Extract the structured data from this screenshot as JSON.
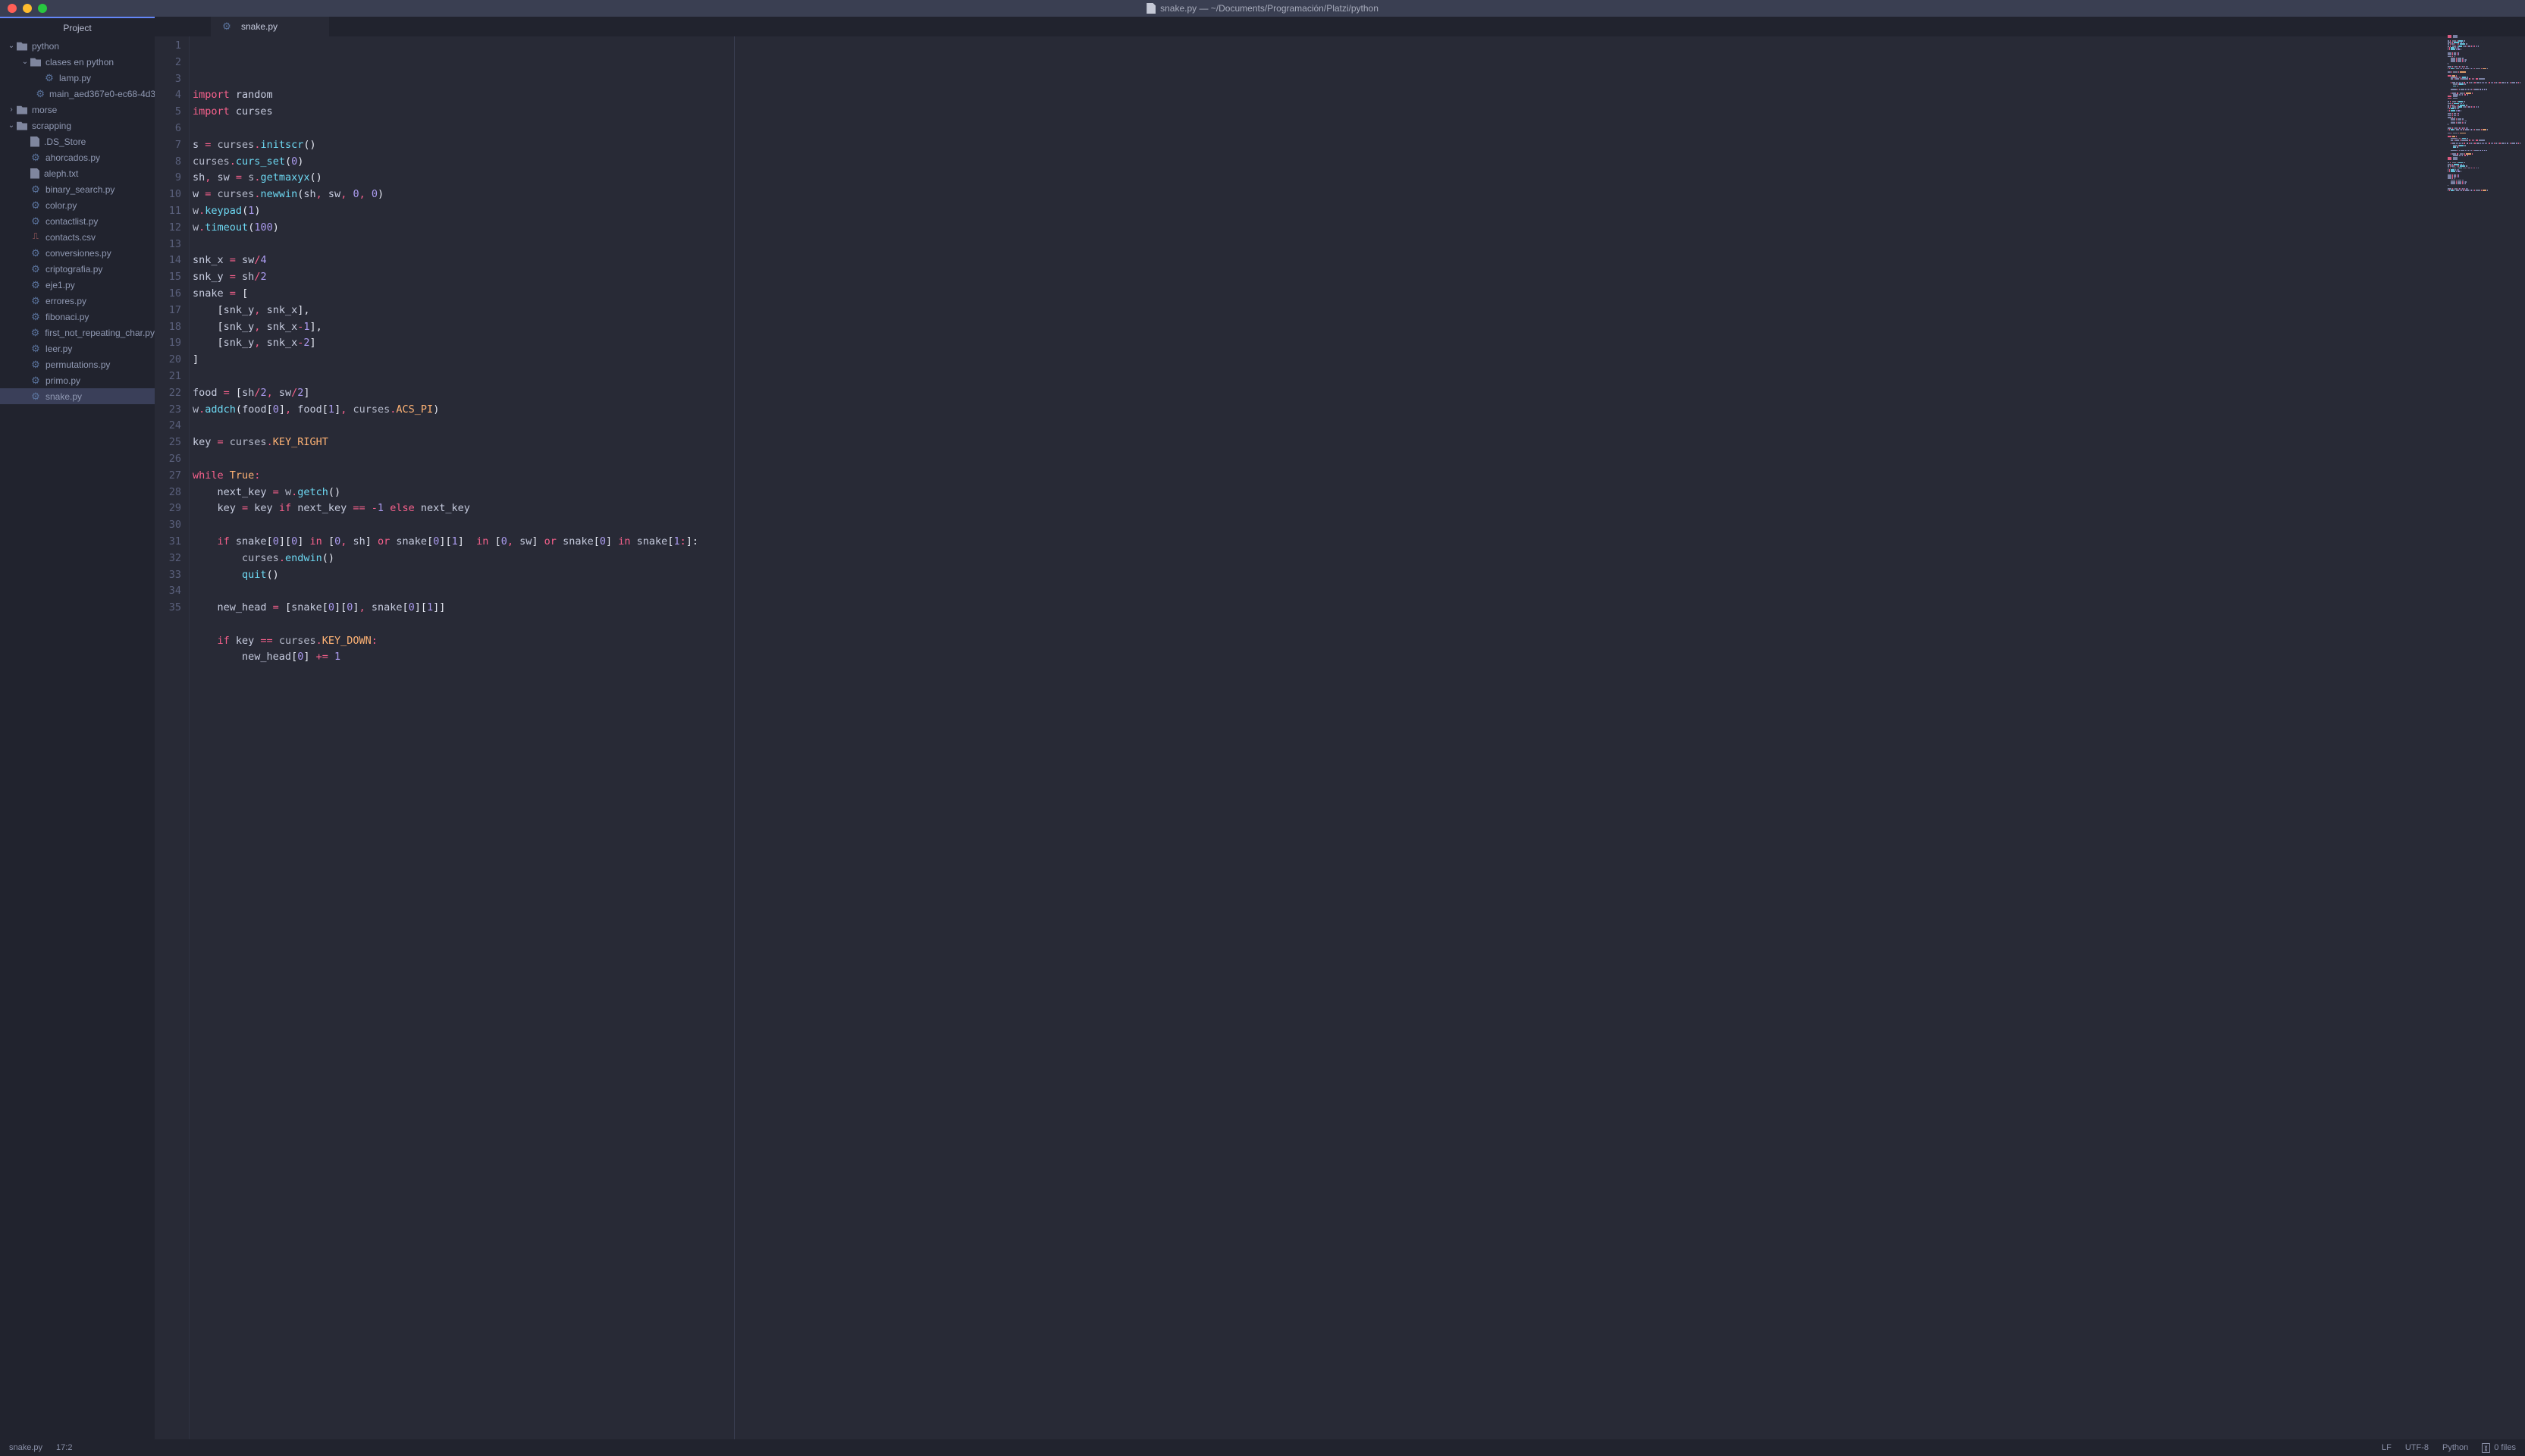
{
  "window": {
    "title": "snake.py — ~/Documents/Programación/Platzi/python"
  },
  "sidebar": {
    "title": "Project",
    "tree": [
      {
        "depth": 0,
        "type": "folder",
        "chev": "down",
        "label": "python"
      },
      {
        "depth": 1,
        "type": "folder",
        "chev": "down",
        "label": "clases en python"
      },
      {
        "depth": 2,
        "type": "py",
        "chev": "none",
        "label": "lamp.py"
      },
      {
        "depth": 2,
        "type": "py",
        "chev": "none",
        "label": "main_aed367e0-ec68-4d3…"
      },
      {
        "depth": 0,
        "type": "folder",
        "chev": "right",
        "label": "morse"
      },
      {
        "depth": 0,
        "type": "folder",
        "chev": "down",
        "label": "scrapping"
      },
      {
        "depth": 1,
        "type": "txt",
        "chev": "none",
        "label": ".DS_Store"
      },
      {
        "depth": 1,
        "type": "py",
        "chev": "none",
        "label": "ahorcados.py"
      },
      {
        "depth": 1,
        "type": "txt",
        "chev": "none",
        "label": "aleph.txt"
      },
      {
        "depth": 1,
        "type": "py",
        "chev": "none",
        "label": "binary_search.py"
      },
      {
        "depth": 1,
        "type": "py",
        "chev": "none",
        "label": "color.py"
      },
      {
        "depth": 1,
        "type": "py",
        "chev": "none",
        "label": "contactlist.py"
      },
      {
        "depth": 1,
        "type": "csv",
        "chev": "none",
        "label": "contacts.csv"
      },
      {
        "depth": 1,
        "type": "py",
        "chev": "none",
        "label": "conversiones.py"
      },
      {
        "depth": 1,
        "type": "py",
        "chev": "none",
        "label": "criptografia.py"
      },
      {
        "depth": 1,
        "type": "py",
        "chev": "none",
        "label": "eje1.py"
      },
      {
        "depth": 1,
        "type": "py",
        "chev": "none",
        "label": "errores.py"
      },
      {
        "depth": 1,
        "type": "py",
        "chev": "none",
        "label": "fibonaci.py"
      },
      {
        "depth": 1,
        "type": "py",
        "chev": "none",
        "label": "first_not_repeating_char.py"
      },
      {
        "depth": 1,
        "type": "py",
        "chev": "none",
        "label": "leer.py"
      },
      {
        "depth": 1,
        "type": "py",
        "chev": "none",
        "label": "permutations.py"
      },
      {
        "depth": 1,
        "type": "py",
        "chev": "none",
        "label": "primo.py"
      },
      {
        "depth": 1,
        "type": "py",
        "chev": "none",
        "label": "snake.py",
        "selected": true
      }
    ]
  },
  "tabs": [
    {
      "label": "snake.py",
      "icon": "python"
    }
  ],
  "code": {
    "lines": [
      [
        [
          "kw",
          "import"
        ],
        [
          "sp",
          " "
        ],
        [
          "var",
          "random"
        ]
      ],
      [
        [
          "kw",
          "import"
        ],
        [
          "sp",
          " "
        ],
        [
          "var",
          "curses"
        ]
      ],
      [],
      [
        [
          "var",
          "s "
        ],
        [
          "op",
          "="
        ],
        [
          "sp",
          " "
        ],
        [
          "builtin",
          "curses"
        ],
        [
          "op",
          "."
        ],
        [
          "fn",
          "initscr"
        ],
        [
          "bracket",
          "()"
        ]
      ],
      [
        [
          "builtin",
          "curses"
        ],
        [
          "op",
          "."
        ],
        [
          "fn",
          "curs_set"
        ],
        [
          "bracket",
          "("
        ],
        [
          "num",
          "0"
        ],
        [
          "bracket",
          ")"
        ]
      ],
      [
        [
          "var",
          "sh"
        ],
        [
          "op",
          ","
        ],
        [
          "var",
          " sw "
        ],
        [
          "op",
          "="
        ],
        [
          "sp",
          " "
        ],
        [
          "builtin",
          "s"
        ],
        [
          "op",
          "."
        ],
        [
          "fn",
          "getmaxyx"
        ],
        [
          "bracket",
          "()"
        ]
      ],
      [
        [
          "var",
          "w "
        ],
        [
          "op",
          "="
        ],
        [
          "sp",
          " "
        ],
        [
          "builtin",
          "curses"
        ],
        [
          "op",
          "."
        ],
        [
          "fn",
          "newwin"
        ],
        [
          "bracket",
          "("
        ],
        [
          "var",
          "sh"
        ],
        [
          "op",
          ","
        ],
        [
          "var",
          " sw"
        ],
        [
          "op",
          ","
        ],
        [
          "sp",
          " "
        ],
        [
          "num",
          "0"
        ],
        [
          "op",
          ","
        ],
        [
          "sp",
          " "
        ],
        [
          "num",
          "0"
        ],
        [
          "bracket",
          ")"
        ]
      ],
      [
        [
          "builtin",
          "w"
        ],
        [
          "op",
          "."
        ],
        [
          "fn",
          "keypad"
        ],
        [
          "bracket",
          "("
        ],
        [
          "num",
          "1"
        ],
        [
          "bracket",
          ")"
        ]
      ],
      [
        [
          "builtin",
          "w"
        ],
        [
          "op",
          "."
        ],
        [
          "fn",
          "timeout"
        ],
        [
          "bracket",
          "("
        ],
        [
          "num",
          "100"
        ],
        [
          "bracket",
          ")"
        ]
      ],
      [],
      [
        [
          "var",
          "snk_x "
        ],
        [
          "op",
          "="
        ],
        [
          "var",
          " sw"
        ],
        [
          "op",
          "/"
        ],
        [
          "num",
          "4"
        ]
      ],
      [
        [
          "var",
          "snk_y "
        ],
        [
          "op",
          "="
        ],
        [
          "var",
          " sh"
        ],
        [
          "op",
          "/"
        ],
        [
          "num",
          "2"
        ]
      ],
      [
        [
          "var",
          "snake "
        ],
        [
          "op",
          "="
        ],
        [
          "sp",
          " "
        ],
        [
          "bracket",
          "["
        ]
      ],
      [
        [
          "sp",
          "    "
        ],
        [
          "bracket",
          "["
        ],
        [
          "var",
          "snk_y"
        ],
        [
          "op",
          ","
        ],
        [
          "var",
          " snk_x"
        ],
        [
          "bracket",
          "],"
        ]
      ],
      [
        [
          "sp",
          "    "
        ],
        [
          "bracket",
          "["
        ],
        [
          "var",
          "snk_y"
        ],
        [
          "op",
          ","
        ],
        [
          "var",
          " snk_x"
        ],
        [
          "op",
          "-"
        ],
        [
          "num",
          "1"
        ],
        [
          "bracket",
          "],"
        ]
      ],
      [
        [
          "sp",
          "    "
        ],
        [
          "bracket",
          "["
        ],
        [
          "var",
          "snk_y"
        ],
        [
          "op",
          ","
        ],
        [
          "var",
          " snk_x"
        ],
        [
          "op",
          "-"
        ],
        [
          "num",
          "2"
        ],
        [
          "bracket",
          "]"
        ]
      ],
      [
        [
          "bracket",
          "]"
        ]
      ],
      [],
      [
        [
          "var",
          "food "
        ],
        [
          "op",
          "="
        ],
        [
          "sp",
          " "
        ],
        [
          "bracket",
          "["
        ],
        [
          "var",
          "sh"
        ],
        [
          "op",
          "/"
        ],
        [
          "num",
          "2"
        ],
        [
          "op",
          ","
        ],
        [
          "var",
          " sw"
        ],
        [
          "op",
          "/"
        ],
        [
          "num",
          "2"
        ],
        [
          "bracket",
          "]"
        ]
      ],
      [
        [
          "builtin",
          "w"
        ],
        [
          "op",
          "."
        ],
        [
          "fn",
          "addch"
        ],
        [
          "bracket",
          "("
        ],
        [
          "var",
          "food"
        ],
        [
          "bracket",
          "["
        ],
        [
          "num",
          "0"
        ],
        [
          "bracket",
          "]"
        ],
        [
          "op",
          ","
        ],
        [
          "var",
          " food"
        ],
        [
          "bracket",
          "["
        ],
        [
          "num",
          "1"
        ],
        [
          "bracket",
          "]"
        ],
        [
          "op",
          ","
        ],
        [
          "sp",
          " "
        ],
        [
          "builtin",
          "curses"
        ],
        [
          "op",
          "."
        ],
        [
          "const",
          "ACS_PI"
        ],
        [
          "bracket",
          ")"
        ]
      ],
      [],
      [
        [
          "var",
          "key "
        ],
        [
          "op",
          "="
        ],
        [
          "sp",
          " "
        ],
        [
          "builtin",
          "curses"
        ],
        [
          "op",
          "."
        ],
        [
          "const",
          "KEY_RIGHT"
        ]
      ],
      [],
      [
        [
          "kw",
          "while"
        ],
        [
          "sp",
          " "
        ],
        [
          "const",
          "True"
        ],
        [
          "op",
          ":"
        ]
      ],
      [
        [
          "sp",
          "    "
        ],
        [
          "var",
          "next_key "
        ],
        [
          "op",
          "="
        ],
        [
          "sp",
          " "
        ],
        [
          "builtin",
          "w"
        ],
        [
          "op",
          "."
        ],
        [
          "fn",
          "getch"
        ],
        [
          "bracket",
          "()"
        ]
      ],
      [
        [
          "sp",
          "    "
        ],
        [
          "var",
          "key "
        ],
        [
          "op",
          "="
        ],
        [
          "var",
          " key "
        ],
        [
          "kw",
          "if"
        ],
        [
          "var",
          " next_key "
        ],
        [
          "op",
          "=="
        ],
        [
          "sp",
          " "
        ],
        [
          "op",
          "-"
        ],
        [
          "num",
          "1"
        ],
        [
          "sp",
          " "
        ],
        [
          "kw",
          "else"
        ],
        [
          "var",
          " next_key"
        ]
      ],
      [],
      [
        [
          "sp",
          "    "
        ],
        [
          "kw",
          "if"
        ],
        [
          "var",
          " snake"
        ],
        [
          "bracket",
          "["
        ],
        [
          "num",
          "0"
        ],
        [
          "bracket",
          "]["
        ],
        [
          "num",
          "0"
        ],
        [
          "bracket",
          "]"
        ],
        [
          "sp",
          " "
        ],
        [
          "op",
          "in"
        ],
        [
          "sp",
          " "
        ],
        [
          "bracket",
          "["
        ],
        [
          "num",
          "0"
        ],
        [
          "op",
          ","
        ],
        [
          "var",
          " sh"
        ],
        [
          "bracket",
          "]"
        ],
        [
          "sp",
          " "
        ],
        [
          "op",
          "or"
        ],
        [
          "var",
          " snake"
        ],
        [
          "bracket",
          "["
        ],
        [
          "num",
          "0"
        ],
        [
          "bracket",
          "]["
        ],
        [
          "num",
          "1"
        ],
        [
          "bracket",
          "]"
        ],
        [
          "sp",
          "  "
        ],
        [
          "op",
          "in"
        ],
        [
          "sp",
          " "
        ],
        [
          "bracket",
          "["
        ],
        [
          "num",
          "0"
        ],
        [
          "op",
          ","
        ],
        [
          "var",
          " sw"
        ],
        [
          "bracket",
          "]"
        ],
        [
          "sp",
          " "
        ],
        [
          "op",
          "or"
        ],
        [
          "var",
          " snake"
        ],
        [
          "bracket",
          "["
        ],
        [
          "num",
          "0"
        ],
        [
          "bracket",
          "]"
        ],
        [
          "sp",
          " "
        ],
        [
          "op",
          "in"
        ],
        [
          "var",
          " snake"
        ],
        [
          "bracket",
          "["
        ],
        [
          "num",
          "1"
        ],
        [
          "op",
          ":"
        ],
        [
          "bracket",
          "]:"
        ]
      ],
      [
        [
          "sp",
          "        "
        ],
        [
          "builtin",
          "curses"
        ],
        [
          "op",
          "."
        ],
        [
          "fn",
          "endwin"
        ],
        [
          "bracket",
          "()"
        ]
      ],
      [
        [
          "sp",
          "        "
        ],
        [
          "fn",
          "quit"
        ],
        [
          "bracket",
          "()"
        ]
      ],
      [],
      [
        [
          "sp",
          "    "
        ],
        [
          "var",
          "new_head "
        ],
        [
          "op",
          "="
        ],
        [
          "sp",
          " "
        ],
        [
          "bracket",
          "["
        ],
        [
          "var",
          "snake"
        ],
        [
          "bracket",
          "["
        ],
        [
          "num",
          "0"
        ],
        [
          "bracket",
          "]["
        ],
        [
          "num",
          "0"
        ],
        [
          "bracket",
          "]"
        ],
        [
          "op",
          ","
        ],
        [
          "var",
          " snake"
        ],
        [
          "bracket",
          "["
        ],
        [
          "num",
          "0"
        ],
        [
          "bracket",
          "]["
        ],
        [
          "num",
          "1"
        ],
        [
          "bracket",
          "]]"
        ]
      ],
      [],
      [
        [
          "sp",
          "    "
        ],
        [
          "kw",
          "if"
        ],
        [
          "var",
          " key "
        ],
        [
          "op",
          "=="
        ],
        [
          "sp",
          " "
        ],
        [
          "builtin",
          "curses"
        ],
        [
          "op",
          "."
        ],
        [
          "const",
          "KEY_DOWN"
        ],
        [
          "op",
          ":"
        ]
      ],
      [
        [
          "sp",
          "        "
        ],
        [
          "var",
          "new_head"
        ],
        [
          "bracket",
          "["
        ],
        [
          "num",
          "0"
        ],
        [
          "bracket",
          "]"
        ],
        [
          "sp",
          " "
        ],
        [
          "op",
          "+="
        ],
        [
          "sp",
          " "
        ],
        [
          "num",
          "1"
        ]
      ]
    ]
  },
  "statusbar": {
    "file": "snake.py",
    "cursor": "17:2",
    "eol": "LF",
    "encoding": "UTF-8",
    "lang": "Python",
    "git": "0 files"
  }
}
